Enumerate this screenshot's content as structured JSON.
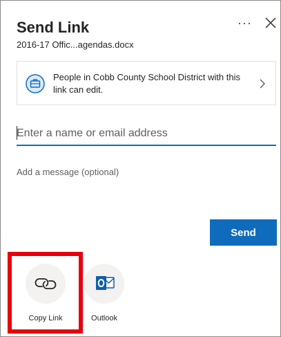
{
  "dialog": {
    "title": "Send Link",
    "filename": "2016-17 Offic...agendas.docx",
    "more_label": "···",
    "close_icon": "close-icon"
  },
  "permission": {
    "text": "People in Cobb County School District with this link can edit.",
    "icon": "briefcase-icon",
    "chevron": "chevron-right-icon"
  },
  "recipient": {
    "placeholder": "Enter a name or email address",
    "value": ""
  },
  "message": {
    "placeholder": "Add a message (optional)",
    "value": ""
  },
  "send_button": {
    "label": "Send"
  },
  "share_options": [
    {
      "label": "Copy Link",
      "icon": "link-icon"
    },
    {
      "label": "Outlook",
      "icon": "outlook-icon"
    }
  ],
  "colors": {
    "accent": "#0f6cbd",
    "highlight": "#e8000d",
    "outlook_blue": "#0f5ea8"
  }
}
